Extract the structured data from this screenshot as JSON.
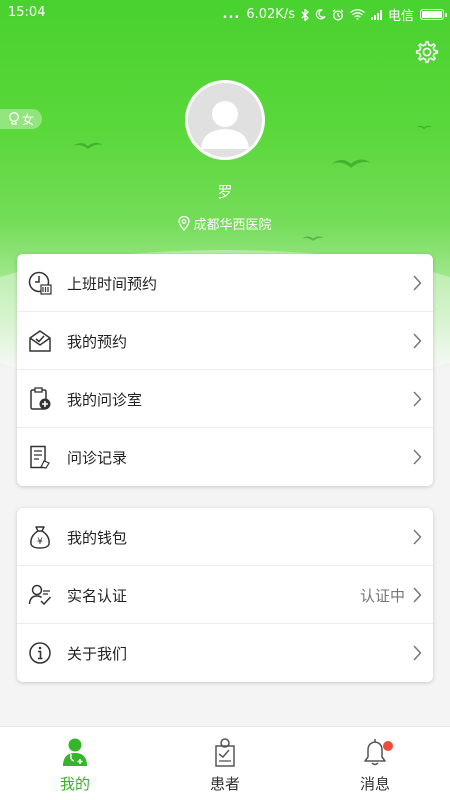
{
  "status_bar": {
    "time": "15:04",
    "net_speed": "6.02K/s",
    "carrier": "电信",
    "dots": "..."
  },
  "profile": {
    "gender_label": "女",
    "name": "罗",
    "hospital": "成都华西医院"
  },
  "menu_group_1": [
    {
      "label": "上班时间预约",
      "icon": "clock-calendar-icon"
    },
    {
      "label": "我的预约",
      "icon": "envelope-check-icon"
    },
    {
      "label": "我的问诊室",
      "icon": "clipboard-plus-icon"
    },
    {
      "label": "问诊记录",
      "icon": "document-edit-icon"
    }
  ],
  "menu_group_2": [
    {
      "label": "我的钱包",
      "icon": "money-bag-icon"
    },
    {
      "label": "实名认证",
      "value": "认证中",
      "icon": "user-verify-icon"
    },
    {
      "label": "关于我们",
      "icon": "info-icon"
    }
  ],
  "tabbar": {
    "tabs": [
      {
        "label": "我的",
        "icon": "doctor-icon",
        "active": true
      },
      {
        "label": "患者",
        "icon": "patient-icon",
        "active": false
      },
      {
        "label": "消息",
        "icon": "bell-icon",
        "active": false,
        "badge": true
      }
    ]
  },
  "colors": {
    "brand_green": "#4fd435",
    "active_tab": "#35b52a",
    "badge_red": "#f04a3a"
  }
}
